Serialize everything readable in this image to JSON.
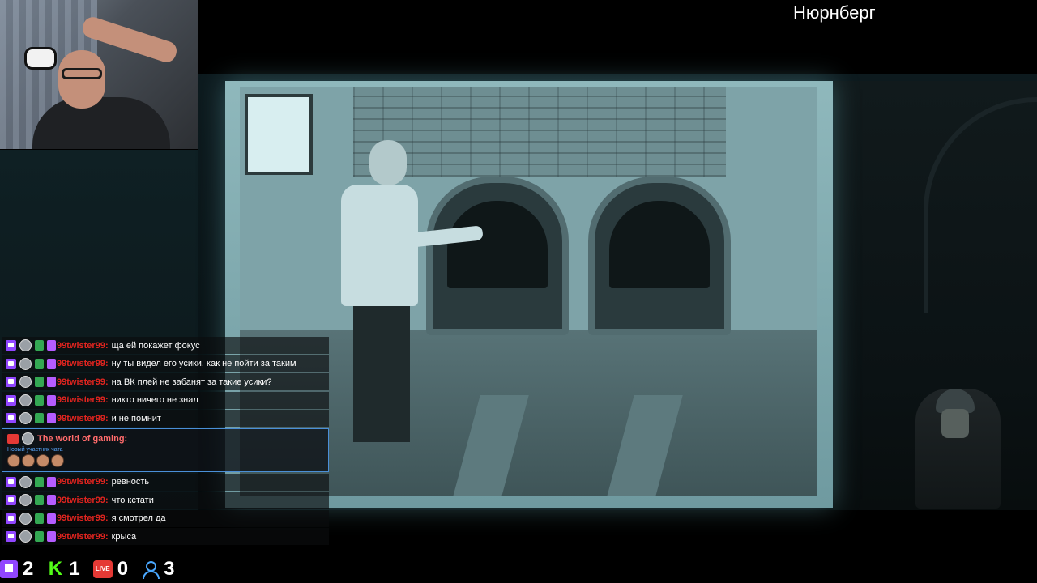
{
  "location": "Нюрнберг",
  "chat": {
    "messages_top": [
      {
        "user": "99twister99",
        "text": "ща ей покажет фокус"
      },
      {
        "user": "99twister99",
        "text": "ну ты видел его усики, как не пойти за таким"
      },
      {
        "user": "99twister99",
        "text": "на ВК плей не забанят за такие усики?"
      },
      {
        "user": "99twister99",
        "text": "никто ничего не знал"
      },
      {
        "user": "99twister99",
        "text": "и не помнит"
      }
    ],
    "featured": {
      "name": "The world of gaming:",
      "subtitle": "Новый участник чата"
    },
    "messages_bottom": [
      {
        "user": "99twister99",
        "text": "ревность"
      },
      {
        "user": "99twister99",
        "text": "что кстати"
      },
      {
        "user": "99twister99",
        "text": "я смотрел да"
      },
      {
        "user": "99twister99",
        "text": "крыса"
      }
    ],
    "colon": ":"
  },
  "stats": {
    "twitch": "2",
    "kick": "1",
    "vkplay": "0",
    "viewers": "3",
    "kick_letter": "K",
    "live_label": "LIVE"
  },
  "colors": {
    "twitch": "#9146ff",
    "kick": "#53fc18",
    "live": "#e53935",
    "username": "#e0241f",
    "viewers": "#4aa8ff"
  },
  "icons": [
    "twitch-icon",
    "avatar-icon",
    "sub-badge-icon",
    "badge-icon",
    "kick-icon",
    "live-icon",
    "viewers-icon"
  ]
}
